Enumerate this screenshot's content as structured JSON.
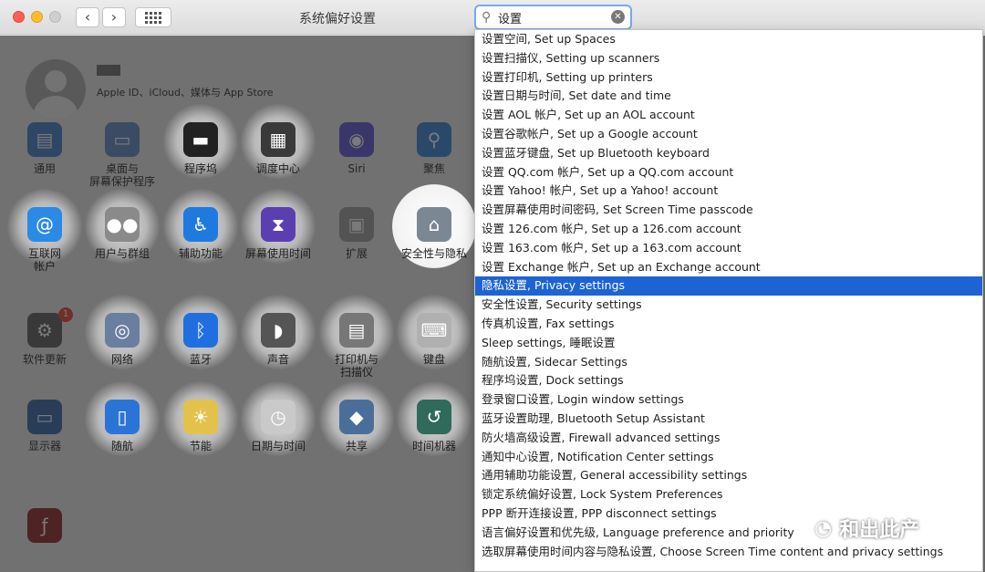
{
  "window": {
    "title": "系统偏好设置"
  },
  "search": {
    "value": "设置",
    "clear_icon": "clear-icon"
  },
  "account": {
    "subtitle": "Apple ID、iCloud、媒体与 App Store"
  },
  "panes": [
    {
      "label": "通用",
      "icon": "general-icon",
      "glyph": "▤",
      "color": "#3a78c8"
    },
    {
      "label": "桌面与\n屏幕保护程序",
      "icon": "desktop-icon",
      "glyph": "▭",
      "color": "#5b83c6"
    },
    {
      "label": "程序坞",
      "icon": "dock-icon",
      "glyph": "▬",
      "color": "#222222"
    },
    {
      "label": "调度中心",
      "icon": "mission-control-icon",
      "glyph": "▦",
      "color": "#3a3a3a"
    },
    {
      "label": "Siri",
      "icon": "siri-icon",
      "glyph": "◉",
      "color": "#5a4ed6"
    },
    {
      "label": "聚焦",
      "icon": "spotlight-icon",
      "glyph": "⚲",
      "color": "#2f7fd6"
    },
    {
      "label": "互联网\n帐户",
      "icon": "internet-accounts-icon",
      "glyph": "@",
      "color": "#2a8ae6"
    },
    {
      "label": "用户与群组",
      "icon": "users-groups-icon",
      "glyph": "●●",
      "color": "#8a8a8a"
    },
    {
      "label": "辅助功能",
      "icon": "accessibility-icon",
      "glyph": "♿",
      "color": "#1f7ae0"
    },
    {
      "label": "屏幕使用时间",
      "icon": "screen-time-icon",
      "glyph": "⧗",
      "color": "#5b3fb0"
    },
    {
      "label": "扩展",
      "icon": "extensions-icon",
      "glyph": "▣",
      "color": "#9a9a9a"
    },
    {
      "label": "安全性与隐私",
      "icon": "security-privacy-icon",
      "glyph": "⌂",
      "color": "#7c8794"
    },
    {
      "label": "软件更新",
      "icon": "software-update-icon",
      "glyph": "⚙",
      "color": "#555555",
      "badge": "1"
    },
    {
      "label": "网络",
      "icon": "network-icon",
      "glyph": "◎",
      "color": "#6a7ea0"
    },
    {
      "label": "蓝牙",
      "icon": "bluetooth-icon",
      "glyph": "ᛒ",
      "color": "#1f6fe0"
    },
    {
      "label": "声音",
      "icon": "sound-icon",
      "glyph": "◗",
      "color": "#555555"
    },
    {
      "label": "打印机与\n扫描仪",
      "icon": "printers-icon",
      "glyph": "▤",
      "color": "#777777"
    },
    {
      "label": "键盘",
      "icon": "keyboard-icon",
      "glyph": "⌨",
      "color": "#b0b0b0"
    },
    {
      "label": "显示器",
      "icon": "displays-icon",
      "glyph": "▭",
      "color": "#2b5fa8"
    },
    {
      "label": "随航",
      "icon": "sidecar-icon",
      "glyph": "▯",
      "color": "#2a74d8"
    },
    {
      "label": "节能",
      "icon": "energy-saver-icon",
      "glyph": "☀",
      "color": "#e2c24a"
    },
    {
      "label": "日期与时间",
      "icon": "date-time-icon",
      "glyph": "◷",
      "color": "#c9c9c9"
    },
    {
      "label": "共享",
      "icon": "sharing-icon",
      "glyph": "◆",
      "color": "#4a6e9a"
    },
    {
      "label": "时间机器",
      "icon": "time-machine-icon",
      "glyph": "↺",
      "color": "#2f6a5a"
    },
    {
      "label": "",
      "icon": "flash-player-icon",
      "glyph": "ƒ",
      "color": "#8a1c1c"
    }
  ],
  "results": [
    "设置空间, Set up Spaces",
    "设置扫描仪, Setting up scanners",
    "设置打印机, Setting up printers",
    "设置日期与时间, Set date and time",
    "设置 AOL 帐户, Set up an AOL account",
    "设置谷歌帐户, Set up a Google account",
    "设置蓝牙键盘, Set up Bluetooth keyboard",
    "设置 QQ.com 帐户, Set up a QQ.com account",
    "设置 Yahoo! 帐户, Set up a Yahoo! account",
    "设置屏幕使用时间密码, Set Screen Time passcode",
    "设置 126.com 帐户, Set up a 126.com account",
    "设置 163.com 帐户, Set up a 163.com account",
    "设置 Exchange 帐户, Set up an Exchange account",
    "隐私设置, Privacy settings",
    "安全性设置, Security settings",
    "传真机设置, Fax settings",
    "Sleep settings, 睡眠设置",
    "随航设置, Sidecar Settings",
    "程序坞设置, Dock settings",
    "登录窗口设置, Login window settings",
    "蓝牙设置助理, Bluetooth Setup Assistant",
    "防火墙高级设置, Firewall advanced settings",
    "通知中心设置, Notification Center settings",
    "通用辅助功能设置, General accessibility settings",
    "锁定系统偏好设置, Lock System Preferences",
    "PPP 断开连接设置, PPP disconnect settings",
    "语言偏好设置和优先级, Language preference and priority",
    "选取屏幕使用时间内容与隐私设置, Choose Screen Time content and privacy settings"
  ],
  "selected_result": 13,
  "watermark": {
    "text": "和出此产"
  }
}
